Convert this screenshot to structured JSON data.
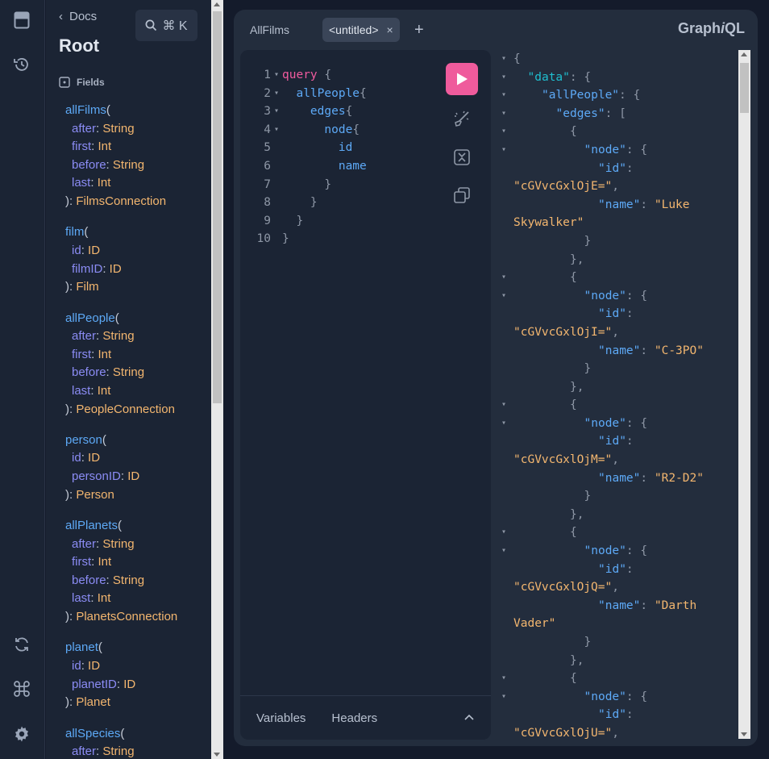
{
  "docs": {
    "back_label": "Docs",
    "title": "Root",
    "search_label": "⌘ K",
    "fields_heading": "Fields",
    "fields": [
      {
        "name": "allFilms",
        "args": [
          [
            "after",
            "String"
          ],
          [
            "first",
            "Int"
          ],
          [
            "before",
            "String"
          ],
          [
            "last",
            "Int"
          ]
        ],
        "returns": "FilmsConnection"
      },
      {
        "name": "film",
        "args": [
          [
            "id",
            "ID"
          ],
          [
            "filmID",
            "ID"
          ]
        ],
        "returns": "Film"
      },
      {
        "name": "allPeople",
        "args": [
          [
            "after",
            "String"
          ],
          [
            "first",
            "Int"
          ],
          [
            "before",
            "String"
          ],
          [
            "last",
            "Int"
          ]
        ],
        "returns": "PeopleConnection"
      },
      {
        "name": "person",
        "args": [
          [
            "id",
            "ID"
          ],
          [
            "personID",
            "ID"
          ]
        ],
        "returns": "Person"
      },
      {
        "name": "allPlanets",
        "args": [
          [
            "after",
            "String"
          ],
          [
            "first",
            "Int"
          ],
          [
            "before",
            "String"
          ],
          [
            "last",
            "Int"
          ]
        ],
        "returns": "PlanetsConnection"
      },
      {
        "name": "planet",
        "args": [
          [
            "id",
            "ID"
          ],
          [
            "planetID",
            "ID"
          ]
        ],
        "returns": "Planet"
      },
      {
        "name": "allSpecies",
        "args": [
          [
            "after",
            "String"
          ]
        ],
        "returns": ""
      }
    ]
  },
  "tabs": [
    {
      "label": "AllFilms",
      "active": false
    },
    {
      "label": "<untitled>",
      "active": true
    }
  ],
  "tab_close": "×",
  "tab_add": "+",
  "brand": {
    "prefix": "Graph",
    "italic": "i",
    "suffix": "QL"
  },
  "editor": {
    "lines": [
      {
        "n": "1",
        "fold": true,
        "parts": [
          [
            "kw",
            "query"
          ],
          [
            "brace",
            " {"
          ]
        ]
      },
      {
        "n": "2",
        "fold": true,
        "parts": [
          [
            "sp",
            "  "
          ],
          [
            "fieldc",
            "allPeople"
          ],
          [
            "brace",
            "{"
          ]
        ]
      },
      {
        "n": "3",
        "fold": true,
        "parts": [
          [
            "sp",
            "    "
          ],
          [
            "fieldc",
            "edges"
          ],
          [
            "brace",
            "{"
          ]
        ]
      },
      {
        "n": "4",
        "fold": true,
        "parts": [
          [
            "sp",
            "      "
          ],
          [
            "fieldc",
            "node"
          ],
          [
            "brace",
            "{"
          ]
        ]
      },
      {
        "n": "5",
        "fold": false,
        "parts": [
          [
            "sp",
            "        "
          ],
          [
            "fieldc",
            "id"
          ]
        ]
      },
      {
        "n": "6",
        "fold": false,
        "parts": [
          [
            "sp",
            "        "
          ],
          [
            "fieldc",
            "name"
          ]
        ]
      },
      {
        "n": "7",
        "fold": false,
        "parts": [
          [
            "sp",
            "      "
          ],
          [
            "brace",
            "}"
          ]
        ]
      },
      {
        "n": "8",
        "fold": false,
        "parts": [
          [
            "sp",
            "    "
          ],
          [
            "brace",
            "}"
          ]
        ]
      },
      {
        "n": "9",
        "fold": false,
        "parts": [
          [
            "sp",
            "  "
          ],
          [
            "brace",
            "}"
          ]
        ]
      },
      {
        "n": "10",
        "fold": false,
        "parts": [
          [
            "brace",
            "}"
          ]
        ]
      }
    ],
    "footer_tabs": [
      "Variables",
      "Headers"
    ]
  },
  "result": {
    "lines": [
      {
        "fold": true,
        "indent": 0,
        "parts": [
          [
            "punc",
            "{"
          ]
        ]
      },
      {
        "fold": true,
        "indent": 2,
        "parts": [
          [
            "key-data",
            "\"data\""
          ],
          [
            "punc",
            ": {"
          ]
        ]
      },
      {
        "fold": true,
        "indent": 4,
        "parts": [
          [
            "key",
            "\"allPeople\""
          ],
          [
            "punc",
            ": {"
          ]
        ]
      },
      {
        "fold": true,
        "indent": 6,
        "parts": [
          [
            "key",
            "\"edges\""
          ],
          [
            "punc",
            ": ["
          ]
        ]
      },
      {
        "fold": true,
        "indent": 8,
        "parts": [
          [
            "punc",
            "{"
          ]
        ]
      },
      {
        "fold": true,
        "indent": 10,
        "parts": [
          [
            "key",
            "\"node\""
          ],
          [
            "punc",
            ": {"
          ]
        ]
      },
      {
        "fold": false,
        "indent": 12,
        "parts": [
          [
            "key",
            "\"id\""
          ],
          [
            "punc",
            ":"
          ]
        ]
      },
      {
        "fold": false,
        "indent": -1,
        "parts": [
          [
            "str",
            "\"cGVvcGxlOjE=\""
          ],
          [
            "punc",
            ","
          ]
        ]
      },
      {
        "fold": false,
        "indent": 12,
        "parts": [
          [
            "key",
            "\"name\""
          ],
          [
            "punc",
            ": "
          ],
          [
            "str",
            "\"Luke"
          ]
        ]
      },
      {
        "fold": false,
        "indent": -1,
        "parts": [
          [
            "str",
            "Skywalker\""
          ]
        ]
      },
      {
        "fold": false,
        "indent": 10,
        "parts": [
          [
            "punc",
            "}"
          ]
        ]
      },
      {
        "fold": false,
        "indent": 8,
        "parts": [
          [
            "punc",
            "},"
          ]
        ]
      },
      {
        "fold": true,
        "indent": 8,
        "parts": [
          [
            "punc",
            "{"
          ]
        ]
      },
      {
        "fold": true,
        "indent": 10,
        "parts": [
          [
            "key",
            "\"node\""
          ],
          [
            "punc",
            ": {"
          ]
        ]
      },
      {
        "fold": false,
        "indent": 12,
        "parts": [
          [
            "key",
            "\"id\""
          ],
          [
            "punc",
            ":"
          ]
        ]
      },
      {
        "fold": false,
        "indent": -1,
        "parts": [
          [
            "str",
            "\"cGVvcGxlOjI=\""
          ],
          [
            "punc",
            ","
          ]
        ]
      },
      {
        "fold": false,
        "indent": 12,
        "parts": [
          [
            "key",
            "\"name\""
          ],
          [
            "punc",
            ": "
          ],
          [
            "str",
            "\"C-3PO\""
          ]
        ]
      },
      {
        "fold": false,
        "indent": 10,
        "parts": [
          [
            "punc",
            "}"
          ]
        ]
      },
      {
        "fold": false,
        "indent": 8,
        "parts": [
          [
            "punc",
            "},"
          ]
        ]
      },
      {
        "fold": true,
        "indent": 8,
        "parts": [
          [
            "punc",
            "{"
          ]
        ]
      },
      {
        "fold": true,
        "indent": 10,
        "parts": [
          [
            "key",
            "\"node\""
          ],
          [
            "punc",
            ": {"
          ]
        ]
      },
      {
        "fold": false,
        "indent": 12,
        "parts": [
          [
            "key",
            "\"id\""
          ],
          [
            "punc",
            ":"
          ]
        ]
      },
      {
        "fold": false,
        "indent": -1,
        "parts": [
          [
            "str",
            "\"cGVvcGxlOjM=\""
          ],
          [
            "punc",
            ","
          ]
        ]
      },
      {
        "fold": false,
        "indent": 12,
        "parts": [
          [
            "key",
            "\"name\""
          ],
          [
            "punc",
            ": "
          ],
          [
            "str",
            "\"R2-D2\""
          ]
        ]
      },
      {
        "fold": false,
        "indent": 10,
        "parts": [
          [
            "punc",
            "}"
          ]
        ]
      },
      {
        "fold": false,
        "indent": 8,
        "parts": [
          [
            "punc",
            "},"
          ]
        ]
      },
      {
        "fold": true,
        "indent": 8,
        "parts": [
          [
            "punc",
            "{"
          ]
        ]
      },
      {
        "fold": true,
        "indent": 10,
        "parts": [
          [
            "key",
            "\"node\""
          ],
          [
            "punc",
            ": {"
          ]
        ]
      },
      {
        "fold": false,
        "indent": 12,
        "parts": [
          [
            "key",
            "\"id\""
          ],
          [
            "punc",
            ":"
          ]
        ]
      },
      {
        "fold": false,
        "indent": -1,
        "parts": [
          [
            "str",
            "\"cGVvcGxlOjQ=\""
          ],
          [
            "punc",
            ","
          ]
        ]
      },
      {
        "fold": false,
        "indent": 12,
        "parts": [
          [
            "key",
            "\"name\""
          ],
          [
            "punc",
            ": "
          ],
          [
            "str",
            "\"Darth"
          ]
        ]
      },
      {
        "fold": false,
        "indent": -1,
        "parts": [
          [
            "str",
            "Vader\""
          ]
        ]
      },
      {
        "fold": false,
        "indent": 10,
        "parts": [
          [
            "punc",
            "}"
          ]
        ]
      },
      {
        "fold": false,
        "indent": 8,
        "parts": [
          [
            "punc",
            "},"
          ]
        ]
      },
      {
        "fold": true,
        "indent": 8,
        "parts": [
          [
            "punc",
            "{"
          ]
        ]
      },
      {
        "fold": true,
        "indent": 10,
        "parts": [
          [
            "key",
            "\"node\""
          ],
          [
            "punc",
            ": {"
          ]
        ]
      },
      {
        "fold": false,
        "indent": 12,
        "parts": [
          [
            "key",
            "\"id\""
          ],
          [
            "punc",
            ":"
          ]
        ]
      },
      {
        "fold": false,
        "indent": -1,
        "parts": [
          [
            "str",
            "\"cGVvcGxlOjU=\""
          ],
          [
            "punc",
            ","
          ]
        ]
      }
    ]
  },
  "icons": {
    "rail_top": [
      "docs-book-icon",
      "history-icon"
    ],
    "rail_bottom": [
      "refetch-schema-icon",
      "shortcuts-command-icon",
      "settings-gear-icon"
    ]
  },
  "colors": {
    "accent_pink": "#ef5b9c",
    "field_blue": "#5da9f6",
    "type_orange": "#f3b66f",
    "arg_purple": "#8b8cf4"
  }
}
